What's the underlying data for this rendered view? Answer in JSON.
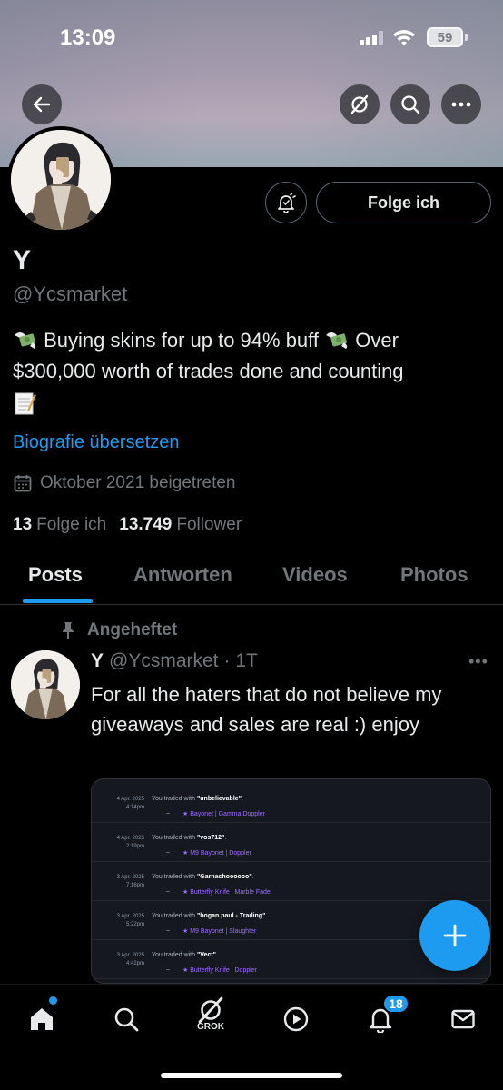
{
  "status_bar": {
    "time": "13:09",
    "battery": "59"
  },
  "profile": {
    "display_name": "Y",
    "handle": "@Ycsmarket",
    "follow_button": "Folge ich",
    "bio_part1": " Buying skins for up to 94% buff ",
    "bio_part2": " Over $300,000 worth of trades done and counting",
    "translate_link": "Biografie übersetzen",
    "joined": "Oktober 2021 beigetreten",
    "following_count": "13",
    "following_label": "Folge ich",
    "followers_count": "13.749",
    "followers_label": "Follower"
  },
  "tabs": [
    {
      "label": "Posts",
      "active": true
    },
    {
      "label": "Antworten",
      "active": false
    },
    {
      "label": "Videos",
      "active": false
    },
    {
      "label": "Photos",
      "active": false
    }
  ],
  "post": {
    "pinned_label": "Angeheftet",
    "name": "Y",
    "handle": "@Ycsmarket",
    "time": "· 1T",
    "more": "•••",
    "text": "For all the haters that do not believe my giveaways and sales are real :) enjoy",
    "trades": [
      {
        "date": "4 Apr. 2025",
        "time": "4:14pm",
        "prefix": "You traded with ",
        "user": "\"unbelievable\"",
        "suffix": ".",
        "dash": "–",
        "item": "★ Bayonet | Gamma Doppler"
      },
      {
        "date": "4 Apr. 2025",
        "time": "2:19pm",
        "prefix": "You traded with ",
        "user": "\"vos712\"",
        "suffix": ".",
        "dash": "–",
        "item": "★ M9 Bayonet | Doppler"
      },
      {
        "date": "3 Apr. 2025",
        "time": "7:16pm",
        "prefix": "You traded with ",
        "user": "\"Garnachoooooo\"",
        "suffix": ".",
        "dash": "–",
        "item": "★ Butterfly Knife | Marble Fade"
      },
      {
        "date": "3 Apr. 2025",
        "time": "5:22pm",
        "prefix": "You traded with ",
        "user": "\"bogan paul - Trading\"",
        "suffix": ".",
        "dash": "–",
        "item": "★ M9 Bayonet | Slaughter"
      },
      {
        "date": "3 Apr. 2025",
        "time": "4:42pm",
        "prefix": "You traded with ",
        "user": "\"Vect\"",
        "suffix": ".",
        "dash": "–",
        "item": "★ Butterfly Knife | Doppler"
      }
    ]
  },
  "bottom_nav": {
    "grok_label": "GROK",
    "notification_count": "18"
  },
  "colors": {
    "accent": "#1d9bf0",
    "background": "#000000",
    "muted": "#71767b",
    "text": "#e7e9ea"
  },
  "icons": [
    "back-arrow-icon",
    "grok-icon",
    "search-icon",
    "more-icon",
    "bell-icon",
    "money-wings-icon",
    "memo-icon",
    "calendar-icon",
    "pin-icon",
    "plus-icon",
    "home-icon",
    "play-icon",
    "envelope-icon"
  ]
}
